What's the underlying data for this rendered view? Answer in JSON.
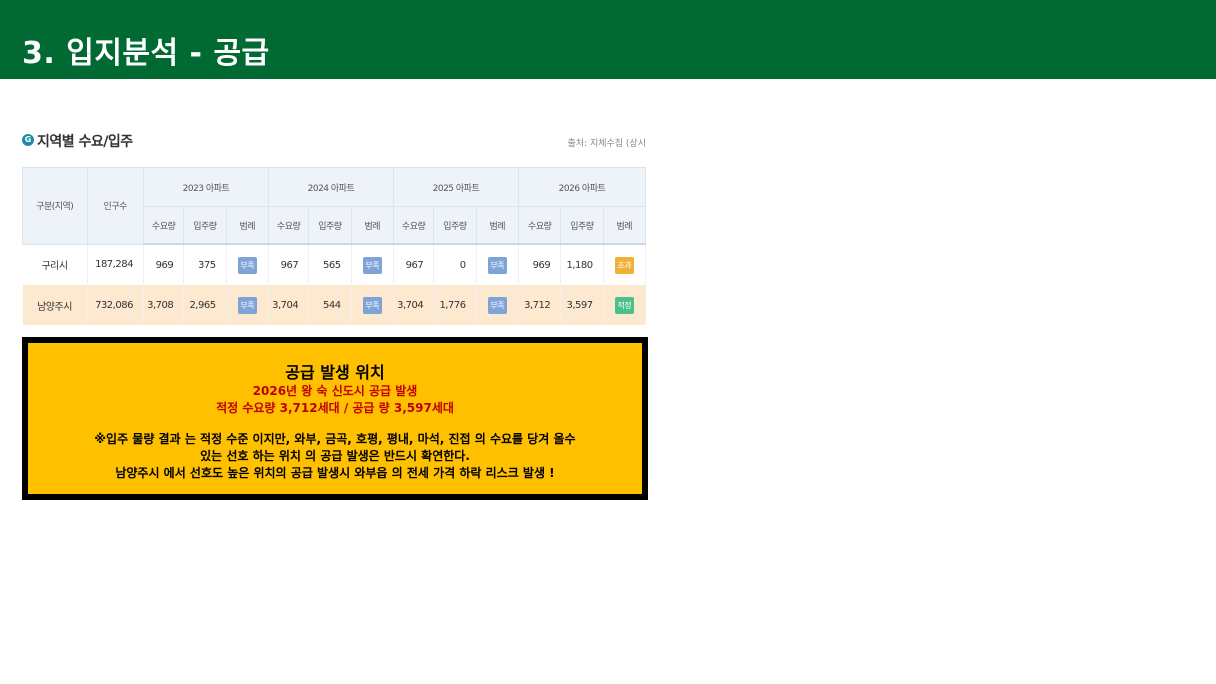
{
  "slide": {
    "title": "3. 입지분석 - 공급"
  },
  "panel": {
    "icon": "G",
    "title": "지역별 수요/입주",
    "source": "출처: 지체수집 (상시"
  },
  "table": {
    "col_region": "구분(지역)",
    "col_population": "인구수",
    "years": [
      "2023 아파트",
      "2024 아파트",
      "2025 아파트",
      "2026 아파트"
    ],
    "sub": {
      "demand": "수요량",
      "supply": "입주량",
      "legend": "범례"
    },
    "rows": [
      {
        "region": "구리시",
        "population": "187,284",
        "cells": [
          {
            "demand": "969",
            "supply": "375",
            "legend": "부족"
          },
          {
            "demand": "967",
            "supply": "565",
            "legend": "부족"
          },
          {
            "demand": "967",
            "supply": "0",
            "legend": "부족"
          },
          {
            "demand": "969",
            "supply": "1,180",
            "legend": "초과"
          }
        ]
      },
      {
        "region": "남양주시",
        "population": "732,086",
        "cells": [
          {
            "demand": "3,708",
            "supply": "2,965",
            "legend": "부족"
          },
          {
            "demand": "3,704",
            "supply": "544",
            "legend": "부족"
          },
          {
            "demand": "3,704",
            "supply": "1,776",
            "legend": "부족"
          },
          {
            "demand": "3,712",
            "supply": "3,597",
            "legend": "적정"
          }
        ]
      }
    ]
  },
  "colors": {
    "부족": "#7ea3d6",
    "초과": "#f0b03a",
    "적정": "#4cc08a"
  },
  "box": {
    "title": "공급 발생 위치",
    "red_line1": "2026년 왕 숙 신도시 공급 발생",
    "red_line2": "적정 수요량 3,712세대 / 공급 량 3,597세대",
    "line1": "※입주 물량 결과 는 적정 수준 이지만, 와부, 금곡, 호평, 평내, 마석, 진접 의 수요를 당겨 올수",
    "line2": "있는 선호 하는 위치 의 공급 발생은 반드시 확연한다.",
    "line3": "남양주시 에서 선호도 높은 위치의 공급 발생시 와부읍 의 전세 가격 하락 리스크 발생 !"
  }
}
